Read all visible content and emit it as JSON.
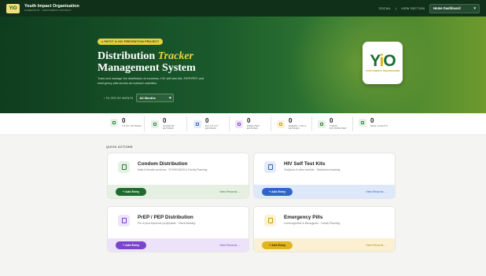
{
  "topbar": {
    "logo_text": "YiO",
    "org_name": "Youth Impact Organisation",
    "org_subtitle": "CAMEROON · NORTHWEST DISTRICT",
    "social_link": "Social",
    "view_section_label": "VIEW SECTION",
    "section_value": "Home Dashboard"
  },
  "hero": {
    "badge": "● PATCT & HIV PREVENTION PROJECT",
    "title_line1_a": "Distribution",
    "title_line1_b": "Tracker",
    "title_line2": "Management System",
    "description": "Track and manage the distribution of condoms, HIV self-test kits, PrEP/PEP, and emergency pills across all outreach activities.",
    "filter_label": "FILTER BY MONTH",
    "filter_value": "All Months",
    "logo_mark_a": "Y",
    "logo_mark_b": "i",
    "logo_mark_c": "O",
    "logo_tag": "YOUTH IMPACT ORGANISATION"
  },
  "stats": [
    {
      "value": "0",
      "label": "TOTAL ENTRIES",
      "color": "#2f7a3a",
      "bg": "#e6f1e6"
    },
    {
      "value": "0",
      "label": "CONDOM ENTRIES",
      "color": "#2f7a3a",
      "bg": "#e6f1e6"
    },
    {
      "value": "0",
      "label": "HIV ST KIT ENTRIES",
      "color": "#2f5fb8",
      "bg": "#e3ebf8"
    },
    {
      "value": "0",
      "label": "PREP/PEP ENTRIES",
      "color": "#7a3fc4",
      "bg": "#eee4f8"
    },
    {
      "value": "0",
      "label": "EMERG. PILLS ENTRIES",
      "color": "#c89a12",
      "bg": "#fbf2d6"
    },
    {
      "value": "0",
      "label": "ITEMS DISTRIBUTED",
      "color": "#2f7a3a",
      "bg": "#e6f1e6"
    },
    {
      "value": "0",
      "label": "NEW CLIENTS",
      "color": "#2f7a3a",
      "bg": "#e6f1e6"
    }
  ],
  "quick_actions": {
    "title": "QUICK ACTIONS",
    "cards": [
      {
        "title": "Condom Distribution",
        "subtitle": "Male & female condoms · STI/HIV/AIDS & Family Planning",
        "add": "+ Add Entry",
        "view": "View Records →",
        "accent": "#1f6a2e",
        "tint": "#e5f0e3",
        "icon_color": "#2f7a3a",
        "icon_bg": "#e6f1e6",
        "link": "#2f7a3a"
      },
      {
        "title": "HIV Self Test Kits",
        "subtitle": "OraQuick & other test kits · Distribution tracking",
        "add": "+ Add Entry",
        "view": "View Records →",
        "accent": "#2f64c8",
        "tint": "#dde8fa",
        "icon_color": "#2f5fb8",
        "icon_bg": "#e3ebf8",
        "link": "#2f5fb8"
      },
      {
        "title": "PrEP / PEP Distribution",
        "subtitle": "Pre & post exposure prophylaxis · Client tracking",
        "add": "+ Add Entry",
        "view": "View Records →",
        "accent": "#7a45cc",
        "tint": "#ece3fa",
        "icon_color": "#7a3fc4",
        "icon_bg": "#eee4f8",
        "link": "#7a3fc4"
      },
      {
        "title": "Emergency Pills",
        "subtitle": "Levonorgestrel & Microgynon · Family Planning",
        "add": "+ Add Entry",
        "view": "View Records →",
        "accent": "#e2b51e",
        "tint": "#fbf1d2",
        "icon_color": "#c89a12",
        "icon_bg": "#fbf2d6",
        "link": "#b8880e"
      }
    ]
  }
}
